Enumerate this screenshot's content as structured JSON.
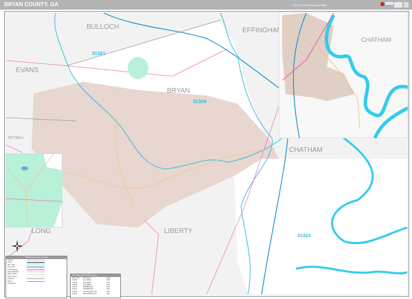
{
  "header": {
    "title": "BRYAN COUNTY, GA",
    "edition": "2020 ZIP Code Premium Edition",
    "logo_text": "Market MAPS"
  },
  "map": {
    "county_labels": [
      "BULLOCH",
      "EFFINGHAM",
      "EVANS",
      "BRYAN",
      "CHATHAM",
      "CHATHAM",
      "TATTNALL",
      "LONG",
      "LIBERTY"
    ],
    "zip_labels": [
      "31321",
      "31308",
      "31324"
    ],
    "colors": {
      "bryan_zip_31308": "#e8d6d0",
      "pembroke_zip": "#ffffff",
      "background": "#f2f2f2",
      "water": "#33ccee",
      "interstate": "#1a8fd0",
      "us_highway": "#ee55aa",
      "state_road": "#f5c48a"
    }
  },
  "legend": {
    "title": "2020 Bryan County, GA Map",
    "items": [
      "County",
      "State",
      "ZIP Code",
      "Interstate",
      "US Highway",
      "State Highway",
      "Major Road",
      "Other Road",
      "Railroad",
      "Water"
    ],
    "population_title": "Population"
  },
  "zip_table": {
    "title": "ZIP Codes within Bryan County",
    "headers": [
      "ZIP Code",
      "ZIP Name",
      "Type"
    ],
    "rows": [
      [
        "31308",
        "ELLABELL",
        "STD"
      ],
      [
        "31308",
        "ELLABELL",
        "STD"
      ],
      [
        "31308",
        "ELLABELL",
        "STD"
      ],
      [
        "31321",
        "PEMBROKE",
        "STD"
      ],
      [
        "31321",
        "PEMBROKE",
        "STD"
      ],
      [
        "31324",
        "RICHMOND HILL",
        "STD"
      ],
      [
        "31324",
        "RICHMOND HILL",
        "STD"
      ]
    ]
  }
}
